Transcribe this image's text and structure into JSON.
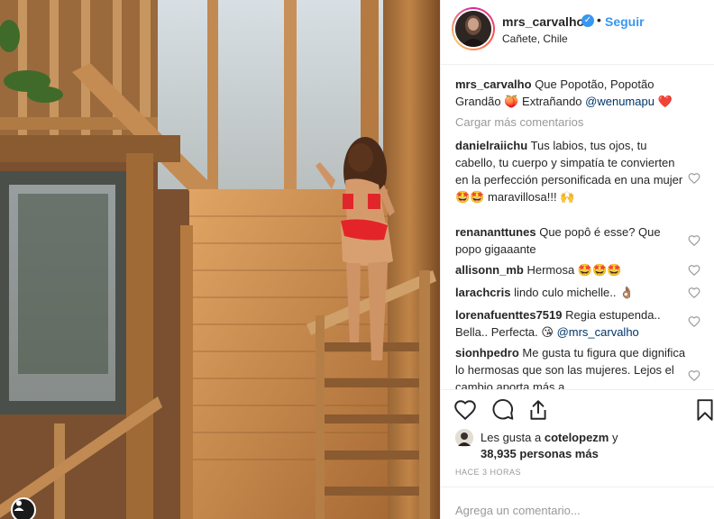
{
  "post": {
    "author": "mrs_carvalho",
    "follow_label": "Seguir",
    "separator": "•",
    "location": "Cañete, Chile",
    "caption": {
      "text_before": "Que Popotão, Popotão Grandão",
      "text_middle": "Extrañando",
      "mention": "@wenumapu",
      "emoji_peach": "🍑",
      "emoji_heart": "❤️"
    },
    "load_more": "Cargar más comentarios"
  },
  "comments": [
    {
      "author": "danielraiichu",
      "text": "Tus labios, tus ojos, tu cabello, tu cuerpo y simpatía te convierten en la perfección personificada en una mujer 🤩🤩 maravillosa!!! 🙌"
    },
    {
      "author": "renananttunes",
      "text": "Que popô é esse? Que popo gigaaante"
    },
    {
      "author": "allisonn_mb",
      "text": "Hermosa 🤩🤩🤩"
    },
    {
      "author": "larachcris",
      "text": "lindo culo michelle.. 👌🏽"
    },
    {
      "author": "lorenafuenttes7519",
      "text": "Regia estupenda.. Bella.. Perfecta. 😘",
      "mention": "@mrs_carvalho"
    },
    {
      "author": "sionhpedro",
      "text": "Me gusta tu figura que dignifica lo hermosas que son las mujeres. Lejos el cambio aporta más a"
    }
  ],
  "likes": {
    "prefix": "Les gusta a",
    "user": "cotelopezm",
    "conj": "y",
    "count": "38,935 personas más"
  },
  "timestamp": "HACE 3 HORAS",
  "add_comment_placeholder": "Agrega un comentario..."
}
